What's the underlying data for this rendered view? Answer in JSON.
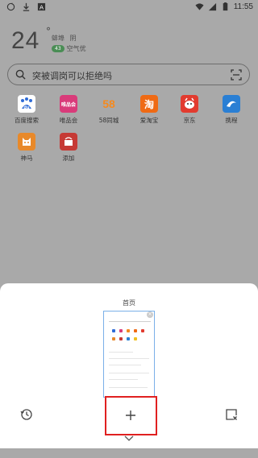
{
  "status_bar": {
    "time": "11:55"
  },
  "weather": {
    "temperature": "24",
    "degree": "°",
    "city": "蚌埠",
    "condition": "阴",
    "aqi": "43",
    "air_quality": "空气优"
  },
  "search": {
    "placeholder": "突被调岗可以拒绝吗"
  },
  "shortcuts": [
    {
      "label": "百度搜索",
      "icon": "baidu-icon",
      "color": "#2e6bd6"
    },
    {
      "label": "唯品会",
      "icon": "vip-icon",
      "color": "#d93b7a",
      "text": "唯品会"
    },
    {
      "label": "58同城",
      "icon": "58-icon",
      "color": "#ffffff",
      "text": "58"
    },
    {
      "label": "爱淘宝",
      "icon": "taobao-icon",
      "color": "#ef6a14",
      "text": "淘"
    },
    {
      "label": "京东",
      "icon": "jd-icon",
      "color": "#e23b2f"
    },
    {
      "label": "携程",
      "icon": "ctrip-icon",
      "color": "#2a7fd4"
    },
    {
      "label": "神马",
      "icon": "shenma-icon",
      "color": "#e8892a"
    },
    {
      "label": "添加",
      "icon": "add-shortcut-icon",
      "color": "#c63a35"
    }
  ],
  "sheet": {
    "title": "首页",
    "thumb_close": "×"
  }
}
